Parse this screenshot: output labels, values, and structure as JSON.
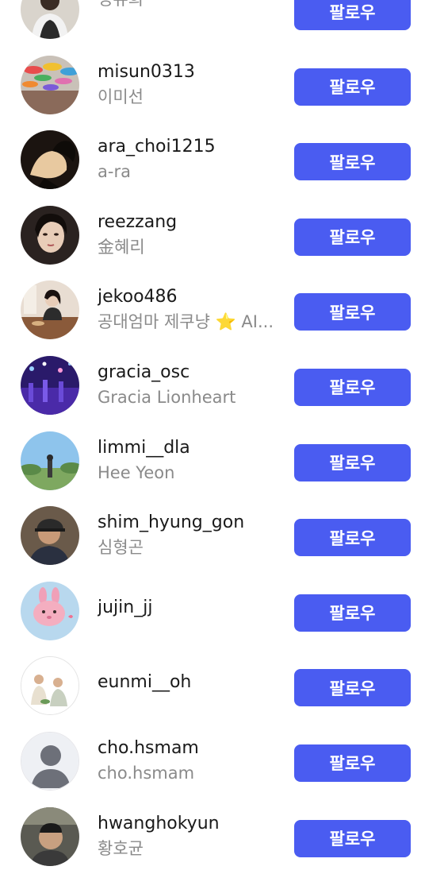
{
  "follow_button_color": "#4a5cf1",
  "users": [
    {
      "username": "",
      "fullname": "정유희",
      "button": "팔로우",
      "avatar": "person-photo-avatar"
    },
    {
      "username": "misun0313",
      "fullname": "이미선",
      "button": "팔로우",
      "avatar": "umbrellas-photo-avatar"
    },
    {
      "username": "ara_choi1215",
      "fullname": "a-ra",
      "button": "팔로우",
      "avatar": "silhouette-sunset-avatar"
    },
    {
      "username": "reezzang",
      "fullname": "金혜리",
      "button": "팔로우",
      "avatar": "woman-portrait-avatar"
    },
    {
      "username": "jekoo486",
      "fullname": "공대엄마 제쿠냥 ⭐ AI...",
      "button": "팔로우",
      "avatar": "woman-cafe-avatar"
    },
    {
      "username": "gracia_osc",
      "fullname": "Gracia Lionheart",
      "button": "팔로우",
      "avatar": "purple-lights-avatar"
    },
    {
      "username": "limmi__dla",
      "fullname": "Hee Yeon",
      "button": "팔로우",
      "avatar": "park-sky-avatar"
    },
    {
      "username": "shim_hyung_gon",
      "fullname": "심형곤",
      "button": "팔로우",
      "avatar": "man-cap-avatar"
    },
    {
      "username": "jujin_jj",
      "fullname": "",
      "button": "팔로우",
      "avatar": "pink-bunny-avatar"
    },
    {
      "username": "eunmi__oh",
      "fullname": "",
      "button": "팔로우",
      "avatar": "family-photo-avatar"
    },
    {
      "username": "cho.hsmam",
      "fullname": "cho.hsmam",
      "button": "팔로우",
      "avatar": "default-user-avatar"
    },
    {
      "username": "hwanghokyun",
      "fullname": "황호균",
      "button": "팔로우",
      "avatar": "man-car-avatar"
    }
  ]
}
